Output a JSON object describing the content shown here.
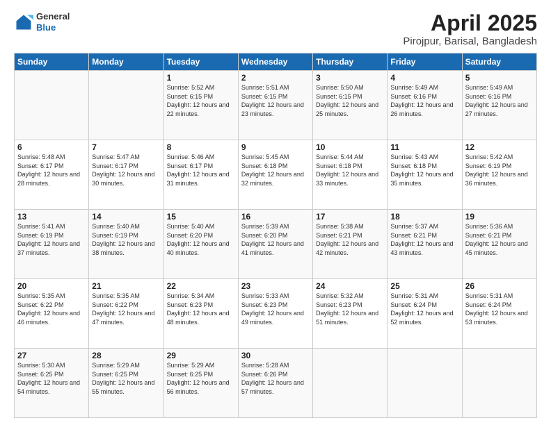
{
  "header": {
    "logo_general": "General",
    "logo_blue": "Blue",
    "main_title": "April 2025",
    "subtitle": "Pirojpur, Barisal, Bangladesh"
  },
  "weekdays": [
    "Sunday",
    "Monday",
    "Tuesday",
    "Wednesday",
    "Thursday",
    "Friday",
    "Saturday"
  ],
  "weeks": [
    [
      {
        "day": "",
        "sunrise": "",
        "sunset": "",
        "daylight": ""
      },
      {
        "day": "",
        "sunrise": "",
        "sunset": "",
        "daylight": ""
      },
      {
        "day": "1",
        "sunrise": "Sunrise: 5:52 AM",
        "sunset": "Sunset: 6:15 PM",
        "daylight": "Daylight: 12 hours and 22 minutes."
      },
      {
        "day": "2",
        "sunrise": "Sunrise: 5:51 AM",
        "sunset": "Sunset: 6:15 PM",
        "daylight": "Daylight: 12 hours and 23 minutes."
      },
      {
        "day": "3",
        "sunrise": "Sunrise: 5:50 AM",
        "sunset": "Sunset: 6:15 PM",
        "daylight": "Daylight: 12 hours and 25 minutes."
      },
      {
        "day": "4",
        "sunrise": "Sunrise: 5:49 AM",
        "sunset": "Sunset: 6:16 PM",
        "daylight": "Daylight: 12 hours and 26 minutes."
      },
      {
        "day": "5",
        "sunrise": "Sunrise: 5:49 AM",
        "sunset": "Sunset: 6:16 PM",
        "daylight": "Daylight: 12 hours and 27 minutes."
      }
    ],
    [
      {
        "day": "6",
        "sunrise": "Sunrise: 5:48 AM",
        "sunset": "Sunset: 6:17 PM",
        "daylight": "Daylight: 12 hours and 28 minutes."
      },
      {
        "day": "7",
        "sunrise": "Sunrise: 5:47 AM",
        "sunset": "Sunset: 6:17 PM",
        "daylight": "Daylight: 12 hours and 30 minutes."
      },
      {
        "day": "8",
        "sunrise": "Sunrise: 5:46 AM",
        "sunset": "Sunset: 6:17 PM",
        "daylight": "Daylight: 12 hours and 31 minutes."
      },
      {
        "day": "9",
        "sunrise": "Sunrise: 5:45 AM",
        "sunset": "Sunset: 6:18 PM",
        "daylight": "Daylight: 12 hours and 32 minutes."
      },
      {
        "day": "10",
        "sunrise": "Sunrise: 5:44 AM",
        "sunset": "Sunset: 6:18 PM",
        "daylight": "Daylight: 12 hours and 33 minutes."
      },
      {
        "day": "11",
        "sunrise": "Sunrise: 5:43 AM",
        "sunset": "Sunset: 6:18 PM",
        "daylight": "Daylight: 12 hours and 35 minutes."
      },
      {
        "day": "12",
        "sunrise": "Sunrise: 5:42 AM",
        "sunset": "Sunset: 6:19 PM",
        "daylight": "Daylight: 12 hours and 36 minutes."
      }
    ],
    [
      {
        "day": "13",
        "sunrise": "Sunrise: 5:41 AM",
        "sunset": "Sunset: 6:19 PM",
        "daylight": "Daylight: 12 hours and 37 minutes."
      },
      {
        "day": "14",
        "sunrise": "Sunrise: 5:40 AM",
        "sunset": "Sunset: 6:19 PM",
        "daylight": "Daylight: 12 hours and 38 minutes."
      },
      {
        "day": "15",
        "sunrise": "Sunrise: 5:40 AM",
        "sunset": "Sunset: 6:20 PM",
        "daylight": "Daylight: 12 hours and 40 minutes."
      },
      {
        "day": "16",
        "sunrise": "Sunrise: 5:39 AM",
        "sunset": "Sunset: 6:20 PM",
        "daylight": "Daylight: 12 hours and 41 minutes."
      },
      {
        "day": "17",
        "sunrise": "Sunrise: 5:38 AM",
        "sunset": "Sunset: 6:21 PM",
        "daylight": "Daylight: 12 hours and 42 minutes."
      },
      {
        "day": "18",
        "sunrise": "Sunrise: 5:37 AM",
        "sunset": "Sunset: 6:21 PM",
        "daylight": "Daylight: 12 hours and 43 minutes."
      },
      {
        "day": "19",
        "sunrise": "Sunrise: 5:36 AM",
        "sunset": "Sunset: 6:21 PM",
        "daylight": "Daylight: 12 hours and 45 minutes."
      }
    ],
    [
      {
        "day": "20",
        "sunrise": "Sunrise: 5:35 AM",
        "sunset": "Sunset: 6:22 PM",
        "daylight": "Daylight: 12 hours and 46 minutes."
      },
      {
        "day": "21",
        "sunrise": "Sunrise: 5:35 AM",
        "sunset": "Sunset: 6:22 PM",
        "daylight": "Daylight: 12 hours and 47 minutes."
      },
      {
        "day": "22",
        "sunrise": "Sunrise: 5:34 AM",
        "sunset": "Sunset: 6:23 PM",
        "daylight": "Daylight: 12 hours and 48 minutes."
      },
      {
        "day": "23",
        "sunrise": "Sunrise: 5:33 AM",
        "sunset": "Sunset: 6:23 PM",
        "daylight": "Daylight: 12 hours and 49 minutes."
      },
      {
        "day": "24",
        "sunrise": "Sunrise: 5:32 AM",
        "sunset": "Sunset: 6:23 PM",
        "daylight": "Daylight: 12 hours and 51 minutes."
      },
      {
        "day": "25",
        "sunrise": "Sunrise: 5:31 AM",
        "sunset": "Sunset: 6:24 PM",
        "daylight": "Daylight: 12 hours and 52 minutes."
      },
      {
        "day": "26",
        "sunrise": "Sunrise: 5:31 AM",
        "sunset": "Sunset: 6:24 PM",
        "daylight": "Daylight: 12 hours and 53 minutes."
      }
    ],
    [
      {
        "day": "27",
        "sunrise": "Sunrise: 5:30 AM",
        "sunset": "Sunset: 6:25 PM",
        "daylight": "Daylight: 12 hours and 54 minutes."
      },
      {
        "day": "28",
        "sunrise": "Sunrise: 5:29 AM",
        "sunset": "Sunset: 6:25 PM",
        "daylight": "Daylight: 12 hours and 55 minutes."
      },
      {
        "day": "29",
        "sunrise": "Sunrise: 5:29 AM",
        "sunset": "Sunset: 6:25 PM",
        "daylight": "Daylight: 12 hours and 56 minutes."
      },
      {
        "day": "30",
        "sunrise": "Sunrise: 5:28 AM",
        "sunset": "Sunset: 6:26 PM",
        "daylight": "Daylight: 12 hours and 57 minutes."
      },
      {
        "day": "",
        "sunrise": "",
        "sunset": "",
        "daylight": ""
      },
      {
        "day": "",
        "sunrise": "",
        "sunset": "",
        "daylight": ""
      },
      {
        "day": "",
        "sunrise": "",
        "sunset": "",
        "daylight": ""
      }
    ]
  ]
}
